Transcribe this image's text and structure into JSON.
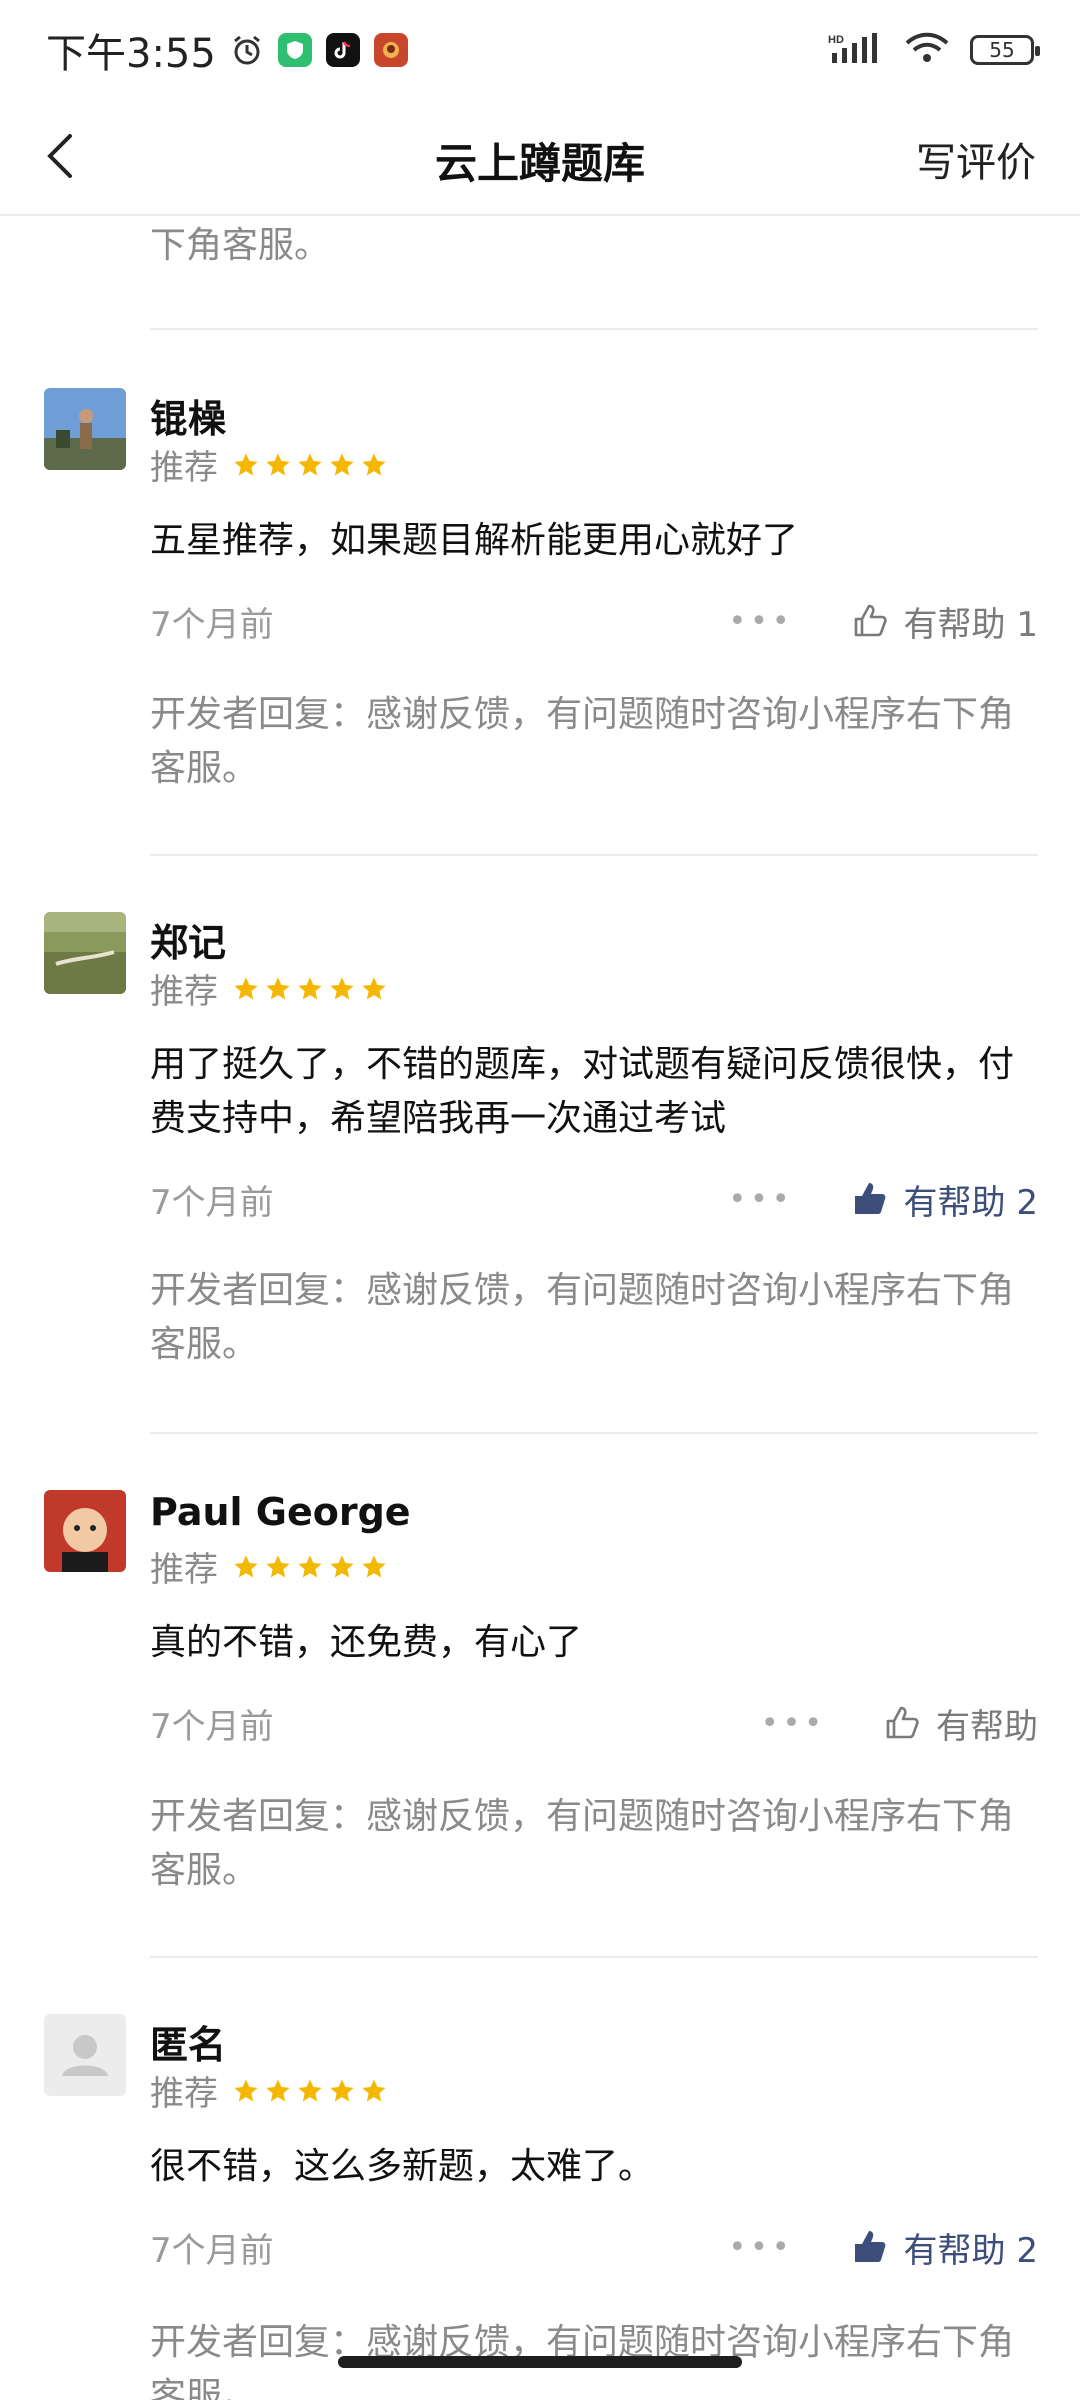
{
  "status_bar": {
    "time": "下午3:55",
    "battery": "55",
    "network": "HD"
  },
  "nav": {
    "title": "云上蹲题库",
    "write_review": "写评价"
  },
  "top_tail_text": "下角客服。",
  "reviews": [
    {
      "name": "锟橾",
      "recommend": "推荐",
      "stars": 5,
      "text": "五星推荐，如果题目解析能更用心就好了",
      "time": "7个月前",
      "helpful_label": "有帮助 1",
      "helpful_active": false,
      "dev_reply": "开发者回复：感谢反馈，有问题随时咨询小程序右下角客服。"
    },
    {
      "name": "郑记",
      "recommend": "推荐",
      "stars": 5,
      "text": "用了挺久了，不错的题库，对试题有疑问反馈很快，付费支持中，希望陪我再一次通过考试",
      "time": "7个月前",
      "helpful_label": "有帮助 2",
      "helpful_active": true,
      "dev_reply": "开发者回复：感谢反馈，有问题随时咨询小程序右下角客服。"
    },
    {
      "name": "Paul George",
      "recommend": "推荐",
      "stars": 5,
      "text": "真的不错，还免费，有心了",
      "time": "7个月前",
      "helpful_label": "有帮助",
      "helpful_active": false,
      "dev_reply": "开发者回复：感谢反馈，有问题随时咨询小程序右下角客服。"
    },
    {
      "name": "匿名",
      "recommend": "推荐",
      "stars": 5,
      "text": "很不错，这么多新题，太难了。",
      "time": "7个月前",
      "helpful_label": "有帮助 2",
      "helpful_active": true,
      "dev_reply": "开发者回复：感谢反馈，有问题随时咨询小程序右下角客服。"
    }
  ],
  "colors": {
    "star": "#f5b800",
    "helpful_active": "#3e4e7a",
    "secondary_text": "#8a8a8a"
  },
  "icons": [
    "alarm-icon",
    "shield-app-icon",
    "tiktok-app-icon",
    "game-app-icon",
    "signal-icon",
    "wifi-icon",
    "battery-icon",
    "back-icon",
    "thumb-up-icon",
    "more-icon",
    "star-icon"
  ]
}
